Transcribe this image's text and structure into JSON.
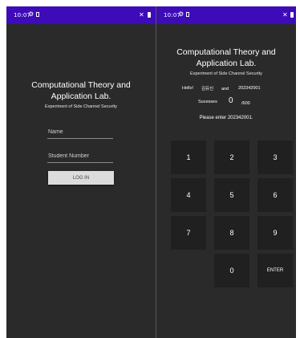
{
  "left": {
    "status": {
      "time": "10:07"
    },
    "title_line1": "Computational Theory and",
    "title_line2": "Application Lab.",
    "subtitle": "Experiment of Side Channel Security",
    "name_placeholder": "Name",
    "student_placeholder": "Student Number",
    "login_label": "LOG IN"
  },
  "right": {
    "status": {
      "time": "10:07"
    },
    "title_line1": "Computational Theory and",
    "title_line2": "Application Lab.",
    "subtitle": "Experiment of Side Channel Security",
    "hello_label": "Hello!",
    "user_name": "김유신",
    "and_label": "and",
    "student_number": "202342001",
    "successes_label": "Sucesses",
    "success_count": "0",
    "success_total": "/600",
    "prompt": "Please enter 202342001.",
    "keys": [
      "1",
      "2",
      "3",
      "4",
      "5",
      "6",
      "7",
      "8",
      "9",
      "0",
      "ENTER"
    ]
  },
  "colors": {
    "status_bar": "#3d0bb8",
    "background": "#2a2a2a",
    "key_background": "#202020",
    "button_background": "#dcdcdc"
  },
  "icons": [
    "gear-icon",
    "sim-icon",
    "mute-icon",
    "battery-icon"
  ]
}
